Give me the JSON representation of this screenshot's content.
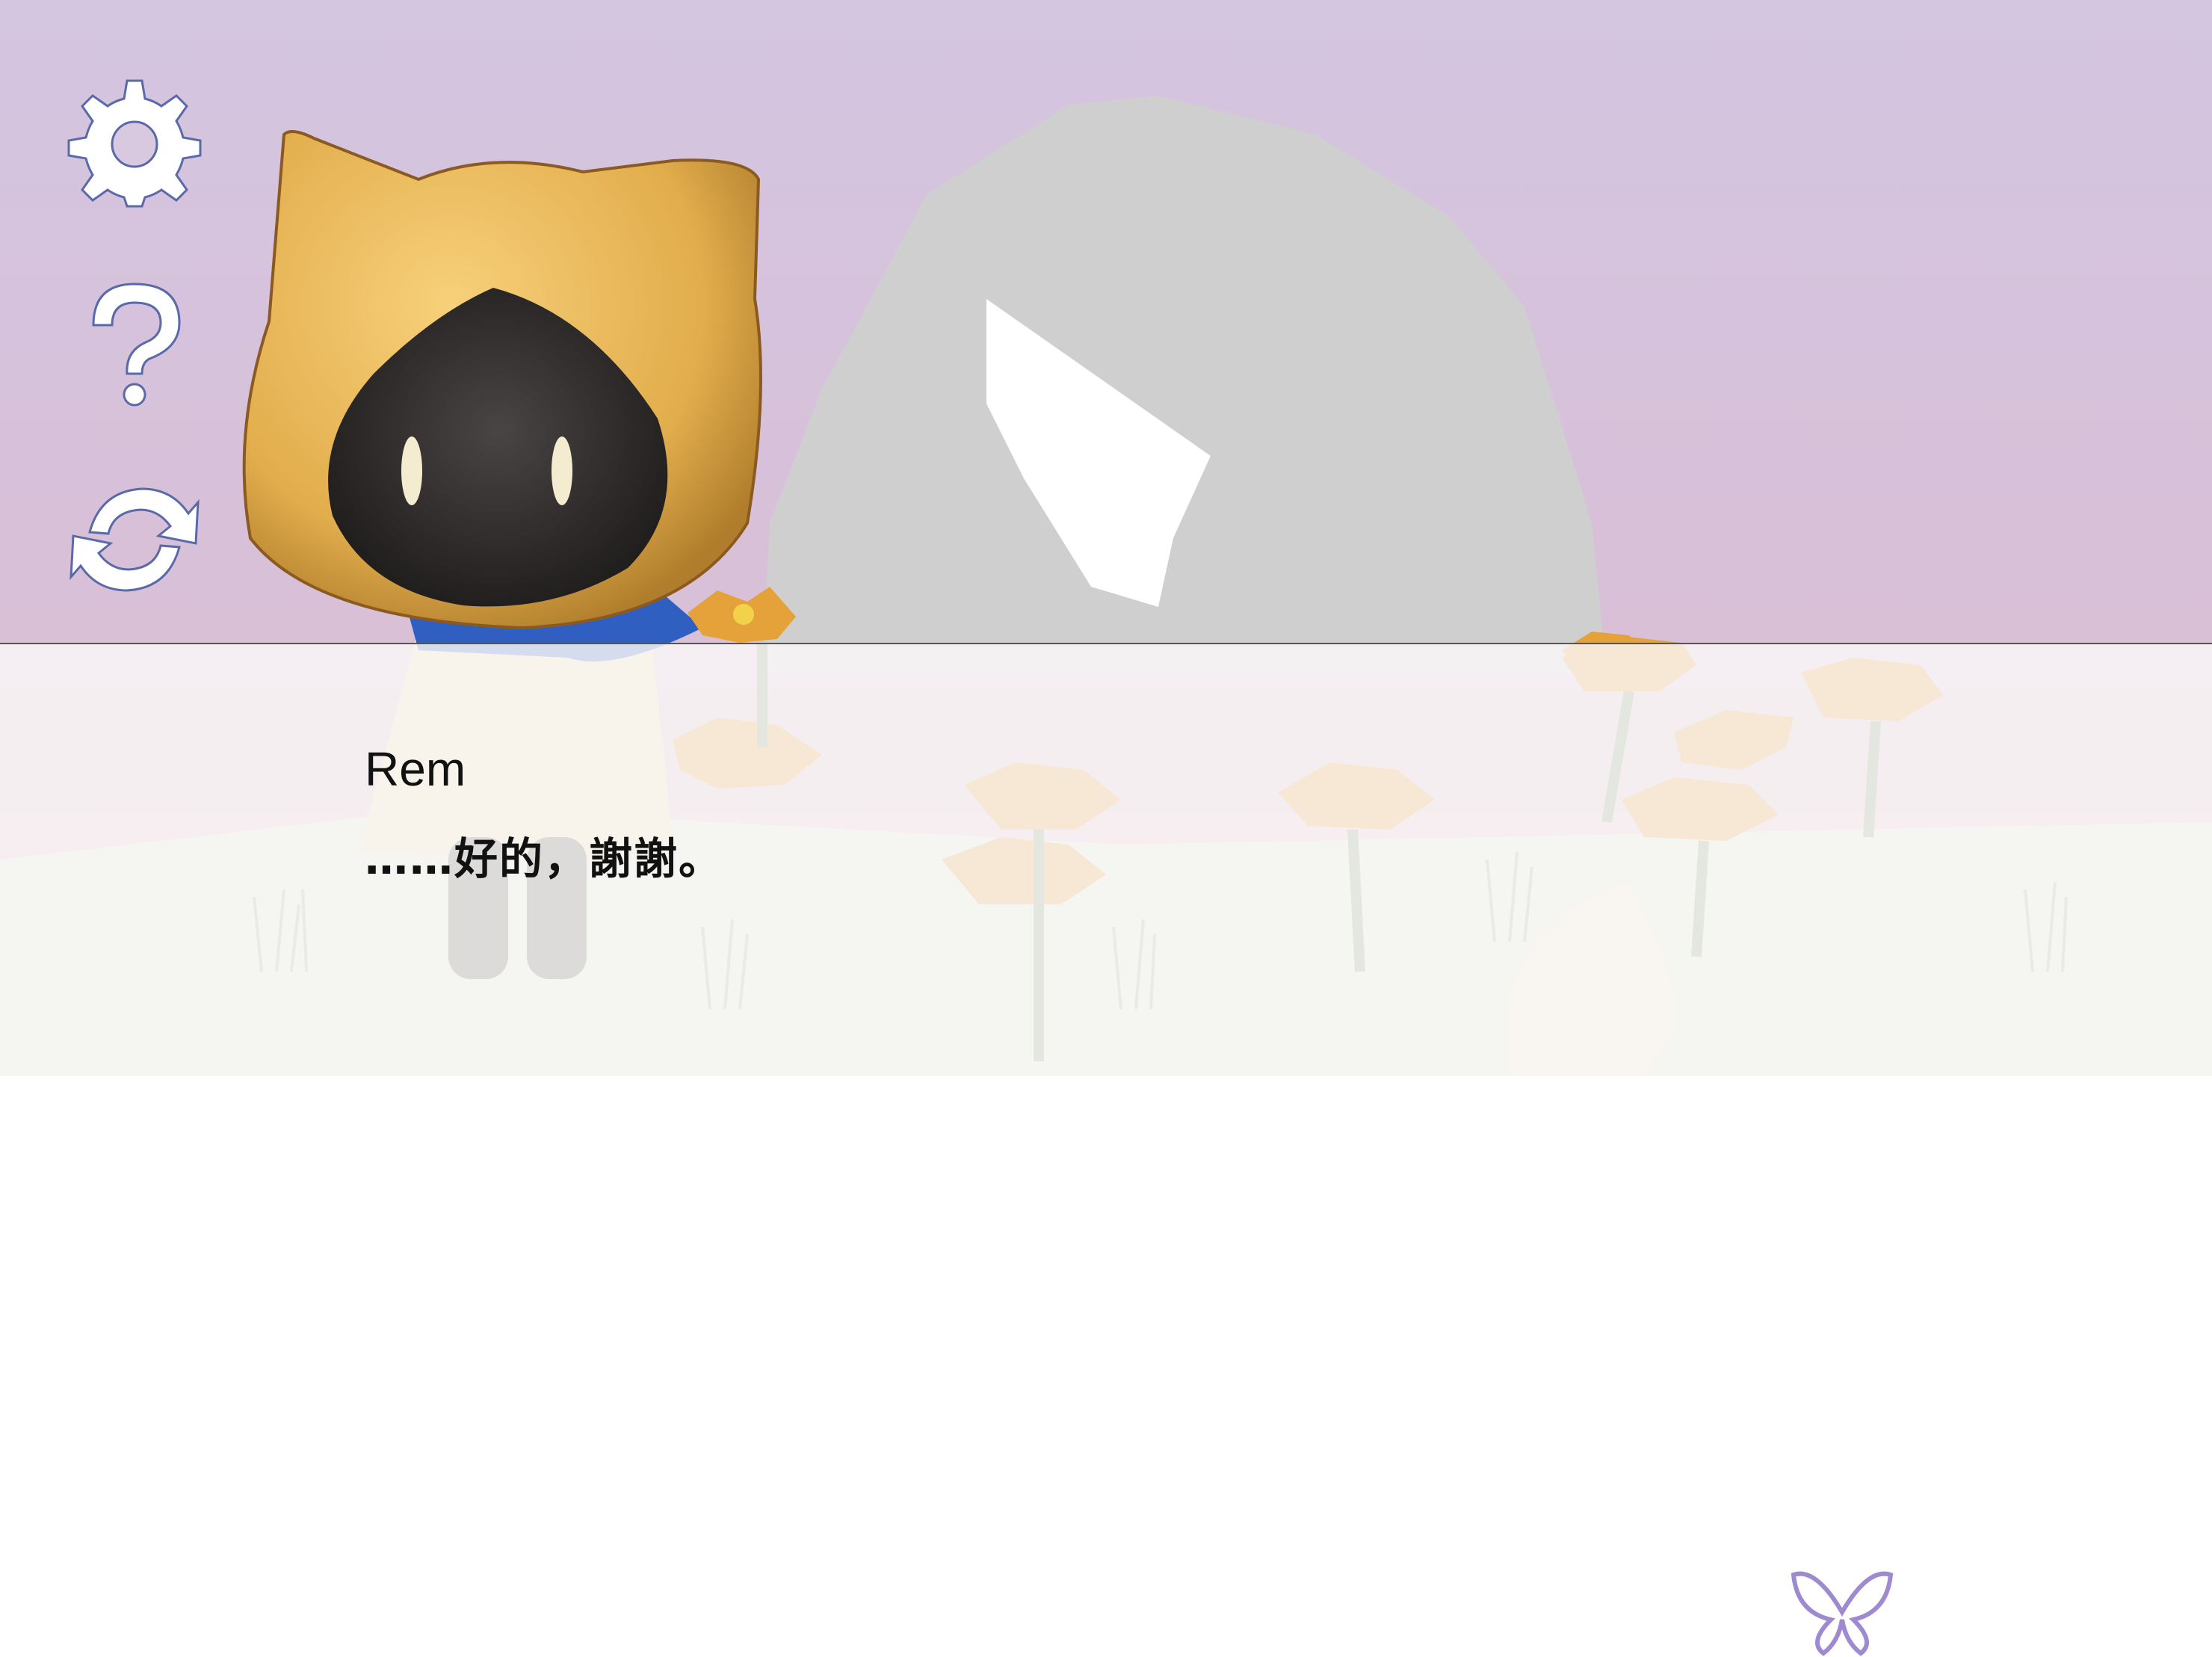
{
  "toolbar": {
    "settings_icon": "gear-icon",
    "help_icon": "question-mark-icon",
    "replay_icon": "refresh-icon"
  },
  "dialog": {
    "speaker": "Rem",
    "text": "……好的，謝謝。"
  },
  "colors": {
    "sky_top": "#d5c6e0",
    "sky_bottom": "#e6c0c8",
    "hood": "#e8b85a",
    "scarf": "#2f5fc0",
    "rock": "#cfcfcf",
    "icon_outline": "#5a6aa8"
  }
}
